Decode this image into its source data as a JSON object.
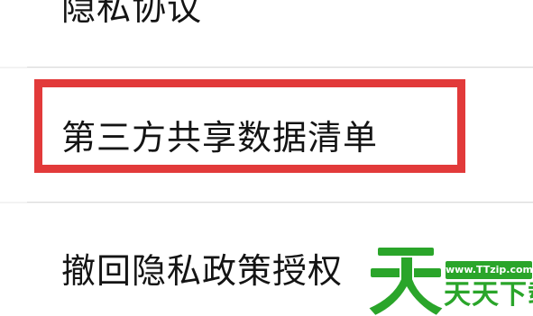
{
  "settings": {
    "items": [
      {
        "label": "隐私协议"
      },
      {
        "label": "第三方共享数据清单",
        "highlighted": true
      },
      {
        "label": "撤回隐私政策授权"
      }
    ]
  },
  "annotation": {
    "highlight_color": "#e23a3a"
  },
  "watermark": {
    "url": "www.TTzip.com",
    "text": "天天下载",
    "color": "#2aa52a"
  }
}
